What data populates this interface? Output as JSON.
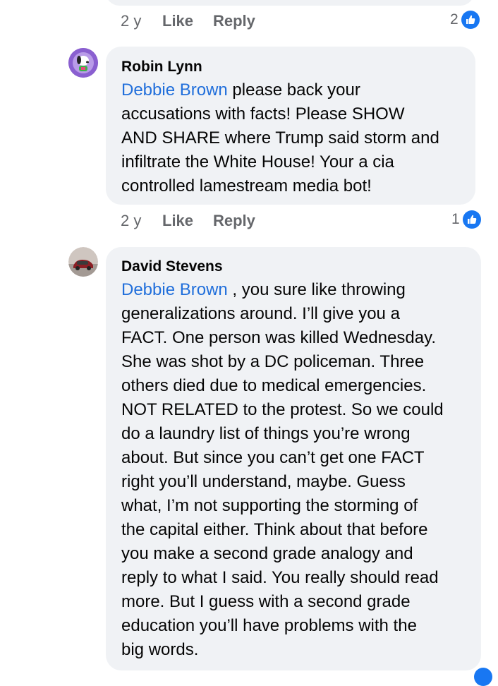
{
  "top_comment_actions": {
    "time": "2 y",
    "like": "Like",
    "reply": "Reply",
    "reaction_count": "2"
  },
  "comments": [
    {
      "author": "Robin Lynn",
      "mention": "Debbie Brown",
      "lines": [
        " please back your",
        "accusations with facts! Please SHOW",
        "AND SHARE where Trump said storm and",
        "infiltrate the White House! Your a cia",
        "controlled lamestream media bot!"
      ],
      "time": "2 y",
      "like": "Like",
      "reply": "Reply",
      "reaction_count": "1",
      "avatar_icon": "snoopy-avatar-icon"
    },
    {
      "author": "David Stevens",
      "mention": "Debbie Brown",
      "lines": [
        " , you sure like throwing",
        "generalizations around. I’ll give you a",
        "FACT. One person was killed Wednesday.",
        "She was shot by a DC policeman. Three",
        "others died due to medical emergencies.",
        "NOT RELATED to the protest. So we could",
        "do a laundry list of things you’re wrong",
        "about. But since you can’t get one FACT",
        "right you’ll understand, maybe. Guess",
        "what, I’m not supporting the storming of",
        "the capital either. Think about that before",
        "you make a second grade analogy and",
        "reply to what I said. You really should read",
        "more. But I guess with a second grade",
        "education you’ll have problems with the",
        "big words."
      ],
      "avatar_icon": "car-avatar-icon"
    }
  ],
  "colors": {
    "bubble": "#f0f2f5",
    "mention": "#216fdb",
    "meta": "#65676b",
    "like_badge": "#1877f2"
  }
}
